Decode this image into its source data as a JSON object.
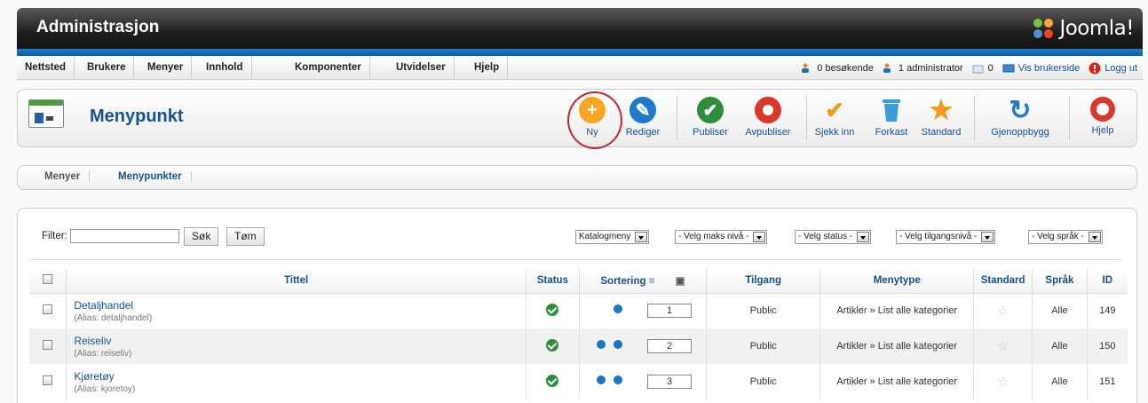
{
  "header": {
    "title": "Administrasjon",
    "logo_text": "Joomla!"
  },
  "menu": [
    "Nettsted",
    "Brukere",
    "Menyer",
    "Innhold",
    "Komponenter",
    "Utvidelser",
    "Hjelp"
  ],
  "status": {
    "visitors": "0 besøkende",
    "admins": "1 administrator",
    "messages": "0",
    "view_site": "Vis brukerside",
    "logout": "Logg ut"
  },
  "page": {
    "title": "Menypunkt"
  },
  "toolbar": [
    {
      "label": "Ny",
      "icon": "plus-icon",
      "color": "#f5a623"
    },
    {
      "label": "Rediger",
      "icon": "pencil-icon",
      "color": "#1f7ac9"
    },
    {
      "label": "Publiser",
      "icon": "check-icon",
      "color": "#2d8d3a"
    },
    {
      "label": "Avpubliser",
      "icon": "circle-icon",
      "color": "#d9382b"
    },
    {
      "label": "Sjekk inn",
      "icon": "checkmark-icon",
      "color": "#f29a1d"
    },
    {
      "label": "Forkast",
      "icon": "trash-icon",
      "color": "#3a9fd9"
    },
    {
      "label": "Standard",
      "icon": "star-icon",
      "color": "#f29a1d"
    },
    {
      "label": "Gjenoppbygg",
      "icon": "refresh-icon",
      "color": "#1f7ac9"
    },
    {
      "label": "Hjelp",
      "icon": "lifebuoy-icon",
      "color": "#d9382b"
    }
  ],
  "tabs": [
    "Menyer",
    "Menypunkter"
  ],
  "filter": {
    "label": "Filter:",
    "value": "",
    "search_button": "Søk",
    "clear_button": "Tøm",
    "selects": [
      "Katalogmeny",
      "- Velg maks nivå -",
      "- Velg status -",
      "- Velg tilgangsnivå -",
      "- Velg språk -"
    ]
  },
  "table": {
    "columns": [
      "Tittel",
      "Status",
      "Sortering",
      "Tilgang",
      "Menytype",
      "Standard",
      "Språk",
      "ID"
    ],
    "rows": [
      {
        "title": "Detaljhandel",
        "alias": "(Alias: detaljhandel)",
        "order": "1",
        "access": "Public",
        "menutype": "Artikler » List alle kategorier",
        "lang": "Alle",
        "id": "149"
      },
      {
        "title": "Reiseliv",
        "alias": "(Alias: reiseliv)",
        "order": "2",
        "access": "Public",
        "menutype": "Artikler » List alle kategorier",
        "lang": "Alle",
        "id": "150"
      },
      {
        "title": "Kjøretøy",
        "alias": "(Alias: kjoretoy)",
        "order": "3",
        "access": "Public",
        "menutype": "Artikler » List alle kategorier",
        "lang": "Alle",
        "id": "151"
      }
    ]
  }
}
